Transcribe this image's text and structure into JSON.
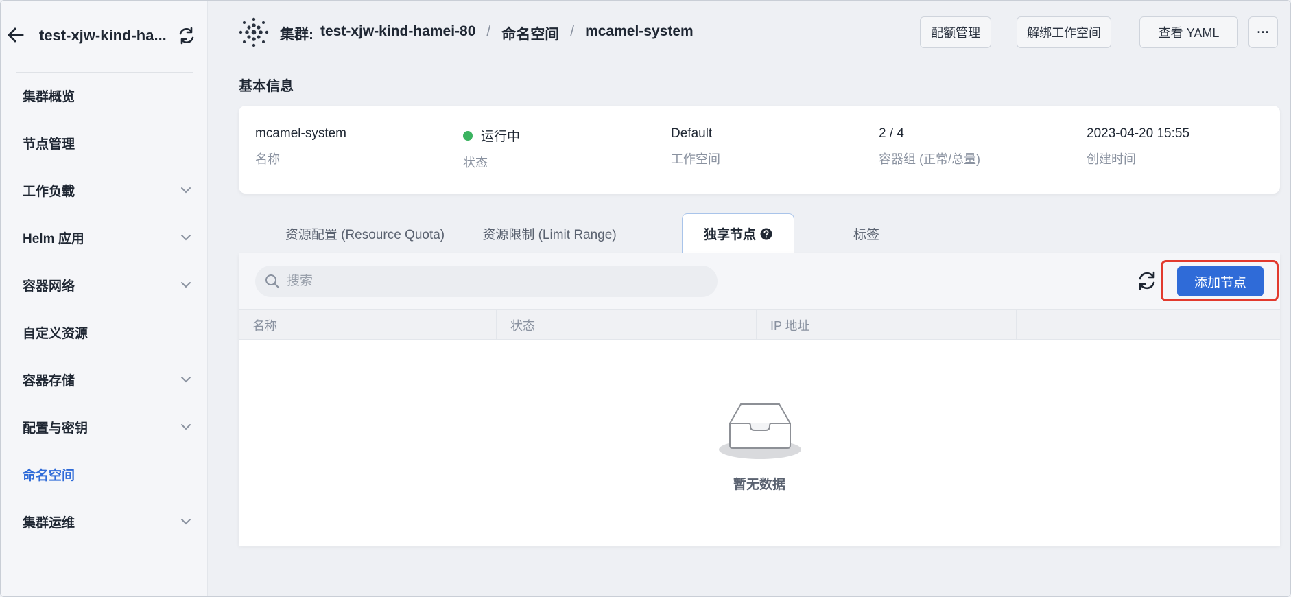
{
  "sidebar": {
    "cluster_name": "test-xjw-kind-ha...",
    "items": [
      {
        "label": "集群概览",
        "expandable": false,
        "active": false
      },
      {
        "label": "节点管理",
        "expandable": false,
        "active": false
      },
      {
        "label": "工作负载",
        "expandable": true,
        "active": false
      },
      {
        "label": "Helm 应用",
        "expandable": true,
        "active": false
      },
      {
        "label": "容器网络",
        "expandable": true,
        "active": false
      },
      {
        "label": "自定义资源",
        "expandable": false,
        "active": false
      },
      {
        "label": "容器存储",
        "expandable": true,
        "active": false
      },
      {
        "label": "配置与密钥",
        "expandable": true,
        "active": false
      },
      {
        "label": "命名空间",
        "expandable": false,
        "active": true
      },
      {
        "label": "集群运维",
        "expandable": true,
        "active": false
      }
    ]
  },
  "header": {
    "cluster_prefix": "集群:",
    "cluster": "test-xjw-kind-hamei-80",
    "separator": "/",
    "namespace_label": "命名空间",
    "namespace": "mcamel-system",
    "buttons": {
      "quota": "配额管理",
      "unbind": "解绑工作空间",
      "yaml": "查看 YAML",
      "more": "···"
    }
  },
  "basic_info": {
    "title": "基本信息",
    "name": {
      "value": "mcamel-system",
      "label": "名称"
    },
    "status": {
      "value": "运行中",
      "label": "状态",
      "color": "#3bb360"
    },
    "workspace": {
      "value": "Default",
      "label": "工作空间"
    },
    "pods": {
      "value": "2 / 4",
      "label": "容器组 (正常/总量)"
    },
    "created": {
      "value": "2023-04-20 15:55",
      "label": "创建时间"
    }
  },
  "tabs": [
    {
      "label": "资源配置 (Resource Quota)",
      "active": false
    },
    {
      "label": "资源限制 (Limit Range)",
      "active": false
    },
    {
      "label": "独享节点",
      "active": true
    },
    {
      "label": "标签",
      "active": false
    }
  ],
  "table": {
    "search_placeholder": "搜索",
    "add_button": "添加节点",
    "columns": [
      "名称",
      "状态",
      "IP 地址",
      ""
    ],
    "empty_text": "暂无数据"
  },
  "colors": {
    "accent": "#2f6bd8",
    "highlight": "#e23a2e",
    "status_running": "#3bb360"
  }
}
